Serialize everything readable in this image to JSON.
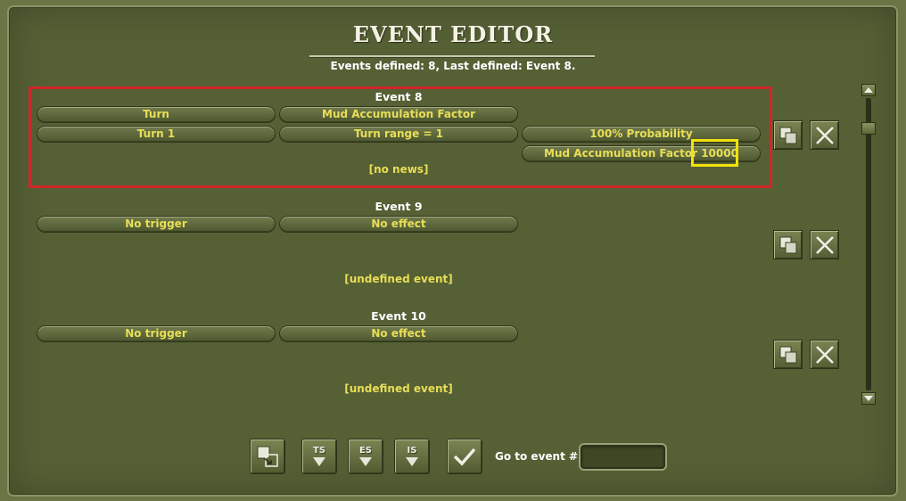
{
  "window": {
    "title": "EVENT EDITOR",
    "summary": "Events defined:  8, Last defined: Event  8."
  },
  "events": [
    {
      "label": "Event 8",
      "trigger_type": "Turn",
      "effect_type": "Mud Accumulation Factor",
      "trigger_param": "Turn 1",
      "effect_param": "Turn range = 1",
      "probability": "100% Probability",
      "effect_value": "Mud Accumulation Factor 10000",
      "news": "[no news]"
    },
    {
      "label": "Event 9",
      "trigger_type": "No trigger",
      "effect_type": "No effect",
      "news": "[undefined event]"
    },
    {
      "label": "Event 10",
      "trigger_type": "No trigger",
      "effect_type": "No effect",
      "news": "[undefined event]"
    }
  ],
  "toolbar": {
    "ts_label": "TS",
    "es_label": "ES",
    "is_label": "IS"
  },
  "goto": {
    "label": "Go to event #:",
    "value": ""
  },
  "icons": {
    "copy": "copy-icon",
    "delete": "close-icon",
    "confirm": "checkmark-icon"
  },
  "colors": {
    "panel": "#566035",
    "pill_text": "#e8de56",
    "highlight_red": "#d0262a",
    "highlight_yellow": "#f2e20c"
  }
}
